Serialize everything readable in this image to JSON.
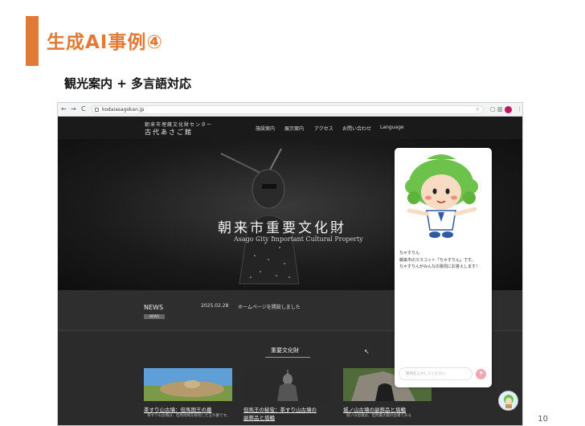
{
  "slide": {
    "title": "生成AI事例④",
    "subtitle": "観光案内 + 多言語対応",
    "page_number": "10"
  },
  "browser": {
    "url": "kodaiasagokan.jp",
    "nav_back": "←",
    "nav_forward": "→",
    "nav_reload": "C"
  },
  "site": {
    "logo_line1": "朝来市埋蔵文化財センター",
    "logo_line2": "古代あさご館",
    "nav": [
      "施設案内",
      "展示案内",
      "アクセス",
      "お問い合わせ",
      "Language"
    ],
    "hero_title": "朝来市重要文化財",
    "hero_subtitle": "Asago City Important Cultural Property",
    "news_label": "NEWS",
    "news_tag": "NEWS",
    "news_date": "2025.02.28",
    "news_text": "ホームページを開設しました",
    "section_title": "重要文化財",
    "cards": [
      {
        "title": "茶すり山古墳：但馬国王の墓",
        "title2": "",
        "desc": "茶すり山古墳は、但馬地域を統括した王の墓です。"
      },
      {
        "title": "但馬王の秘宝：茶すり山古墳の",
        "title2": "副葬品と埴輪",
        "desc": ""
      },
      {
        "title": "城ノ山古墳の副葬品と埴輪",
        "title2": "",
        "desc": "城ノ山古墳は、但馬最大級の古墳である"
      }
    ]
  },
  "chat": {
    "name": "ちゃすりん",
    "line1": "朝来市のマスコット「ちゃすりん」です。",
    "line2": "ちゃすりんがみんなの質問にお答えします！",
    "input_placeholder": "質問を入力してください"
  },
  "colors": {
    "accent": "#e07a36",
    "site_bg": "#2b2b2b",
    "send_button": "#f5a6b0"
  }
}
